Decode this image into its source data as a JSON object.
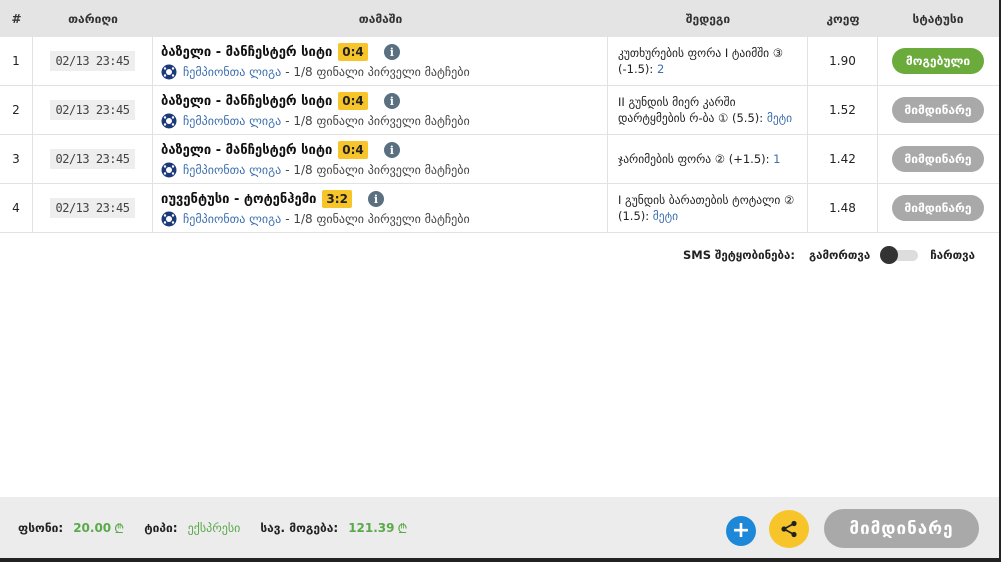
{
  "columns": {
    "num": "#",
    "date": "თარიღი",
    "game": "თამაში",
    "outcome": "შედეგი",
    "odd": "კოეფ",
    "status": "სტატუსი"
  },
  "rows": [
    {
      "num": "1",
      "date": "02/13 23:45",
      "match": "ბაზელი - მანჩესტერ სიტი",
      "score": "0:4",
      "league": "ჩემპიონთა ლიგა",
      "stage": "- 1/8 ფინალი პირველი მატჩები",
      "outcome": "კუთხურების ფორა I ტაიმში ③ (-1.5):",
      "outcome_pick": "2",
      "odd": "1.90",
      "status": "მოგებული",
      "status_type": "won"
    },
    {
      "num": "2",
      "date": "02/13 23:45",
      "match": "ბაზელი - მანჩესტერ სიტი",
      "score": "0:4",
      "league": "ჩემპიონთა ლიგა",
      "stage": "- 1/8 ფინალი პირველი მატჩები",
      "outcome": "II გუნდის მიერ კარში დარტყმების რ-ბა ① (5.5):",
      "outcome_pick": "მეტი",
      "odd": "1.52",
      "status": "მიმდინარე",
      "status_type": "pending"
    },
    {
      "num": "3",
      "date": "02/13 23:45",
      "match": "ბაზელი - მანჩესტერ სიტი",
      "score": "0:4",
      "league": "ჩემპიონთა ლიგა",
      "stage": "- 1/8 ფინალი პირველი მატჩები",
      "outcome": "ჯარიმების ფორა ② (+1.5):",
      "outcome_pick": "1",
      "odd": "1.42",
      "status": "მიმდინარე",
      "status_type": "pending"
    },
    {
      "num": "4",
      "date": "02/13 23:45",
      "match": "იუვენტუსი - ტოტენჰემი",
      "score": "3:2",
      "league": "ჩემპიონთა ლიგა",
      "stage": "- 1/8 ფინალი პირველი მატჩები",
      "outcome": "I გუნდის ბარათების ტოტალი ② (1.5):",
      "outcome_pick": "მეტი",
      "odd": "1.48",
      "status": "მიმდინარე",
      "status_type": "pending"
    }
  ],
  "sms": {
    "label": "SMS შეტყობინება:",
    "off": "გამორთვა",
    "on": "ჩართვა",
    "enabled": false
  },
  "footer": {
    "stake_label": "ფსონი:",
    "stake_value": "20.00",
    "type_label": "ტიპი:",
    "type_value": "ექსპრესი",
    "win_label": "სავ. მოგება:",
    "win_value": "121.39",
    "currency": "₾",
    "status_button": "მიმდინარე"
  },
  "colors": {
    "won": "#6aab3c",
    "pending": "#a9a9a9",
    "score_bg": "#f7c52a",
    "accent_blue": "#1e88d8",
    "money_green": "#5aa94a"
  }
}
